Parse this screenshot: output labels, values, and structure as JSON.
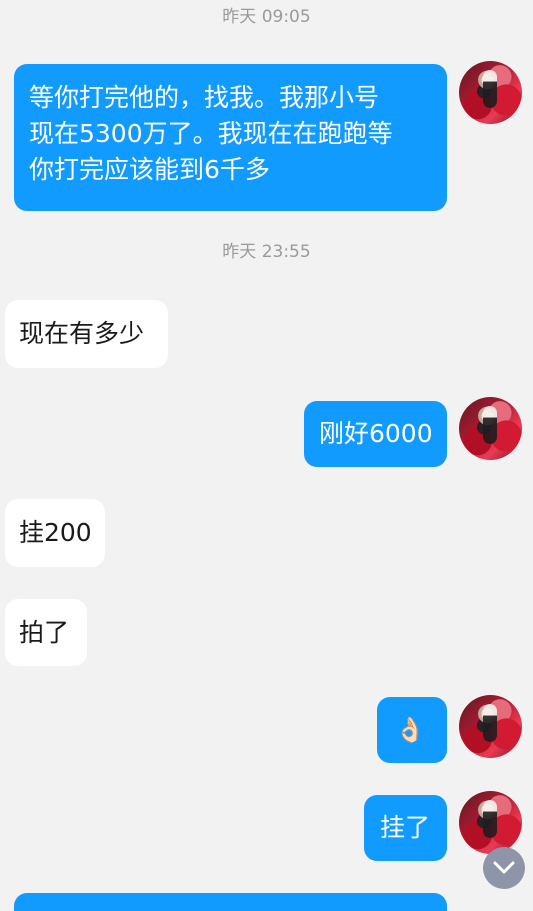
{
  "chat": {
    "timestamps": [
      "昨天 09:05",
      "昨天 23:55"
    ],
    "messages": [
      {
        "sender": "me",
        "lines": [
          "等你打完他的，找我。我那小号",
          "现在5300万了。我现在在跑跑等",
          "你打完应该能到6千多"
        ]
      },
      {
        "sender": "other",
        "text": "现在有多少"
      },
      {
        "sender": "me",
        "text": "刚好6000"
      },
      {
        "sender": "other",
        "text": "挂200"
      },
      {
        "sender": "other",
        "text": "拍了"
      },
      {
        "sender": "me",
        "text": "👌🏻"
      },
      {
        "sender": "me",
        "text": "挂了"
      }
    ]
  },
  "icons": {
    "avatar": "avatar",
    "scroll_down": "chevron-down-icon"
  },
  "colors": {
    "background": "#f2f2f2",
    "outgoing_bubble": "#129bff",
    "incoming_bubble": "#ffffff",
    "timestamp": "#9a9a9a",
    "scroll_button": "#8e95a8"
  }
}
